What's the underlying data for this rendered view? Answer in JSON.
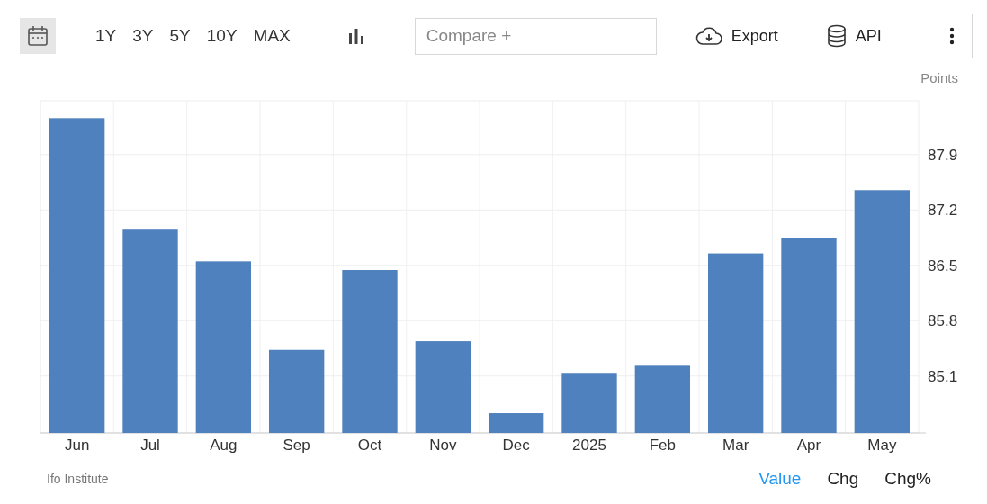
{
  "toolbar": {
    "ranges": [
      {
        "label": "1Y",
        "selected": false
      },
      {
        "label": "3Y",
        "selected": false
      },
      {
        "label": "5Y",
        "selected": false
      },
      {
        "label": "10Y",
        "selected": false
      },
      {
        "label": "MAX",
        "selected": false
      }
    ],
    "compare": {
      "placeholder": "Compare +"
    },
    "export": "Export",
    "api": "API"
  },
  "chart": {
    "chart_data": {
      "type": "bar",
      "grid": true,
      "categories": [
        "Jun",
        "Jul",
        "Aug",
        "Sep",
        "Oct",
        "Nov",
        "Dec",
        "2025",
        "Feb",
        "Mar",
        "Apr",
        "May"
      ],
      "series": [
        {
          "name": "Points",
          "color": "#4e81bd",
          "values": [
            88.36,
            86.95,
            86.55,
            85.43,
            86.44,
            85.54,
            84.63,
            85.14,
            85.23,
            86.65,
            86.85,
            87.45
          ]
        }
      ],
      "ylim": [
        84.38,
        88.58
      ],
      "yticks": [
        85.1,
        85.8,
        86.5,
        87.2,
        87.9
      ]
    }
  },
  "footer": {
    "source": "Ifo Institute",
    "views": [
      {
        "label": "Value",
        "selected": true
      },
      {
        "label": "Chg",
        "selected": false
      },
      {
        "label": "Chg%",
        "selected": false
      }
    ]
  }
}
